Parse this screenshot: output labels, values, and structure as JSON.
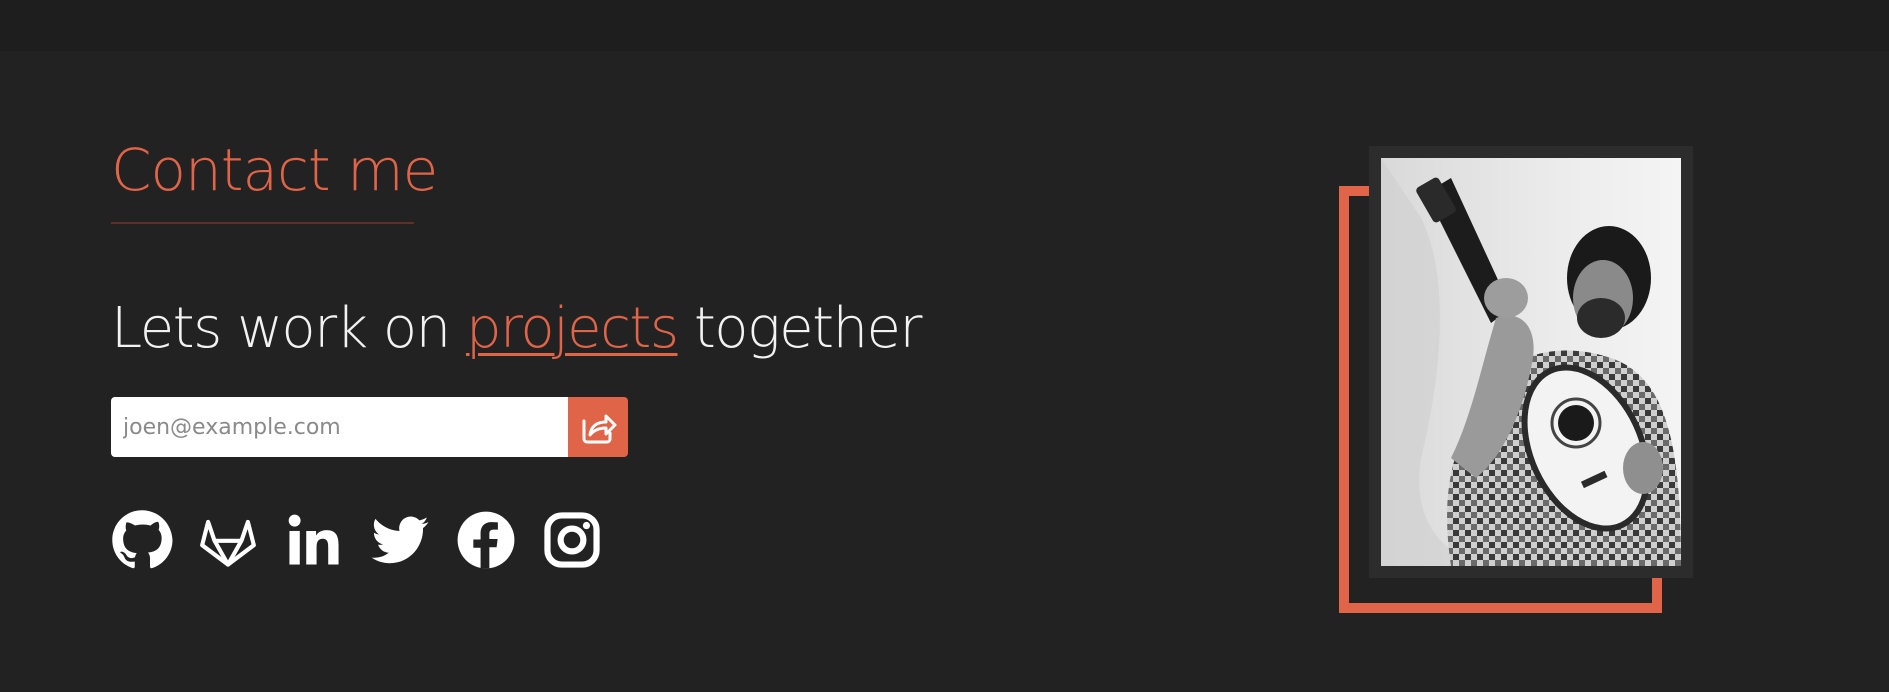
{
  "contact": {
    "heading": "Contact me",
    "tagline_before": "Lets work on ",
    "tagline_highlight": "projects",
    "tagline_after": " together",
    "email_placeholder": "joen@example.com",
    "send_icon": "share-icon"
  },
  "socials": [
    {
      "icon": "github-icon"
    },
    {
      "icon": "gitlab-icon"
    },
    {
      "icon": "linkedin-icon"
    },
    {
      "icon": "twitter-icon"
    },
    {
      "icon": "facebook-icon"
    },
    {
      "icon": "instagram-icon"
    }
  ],
  "colors": {
    "accent": "#e06448",
    "background": "#222222",
    "text": "#f2f2f2"
  }
}
